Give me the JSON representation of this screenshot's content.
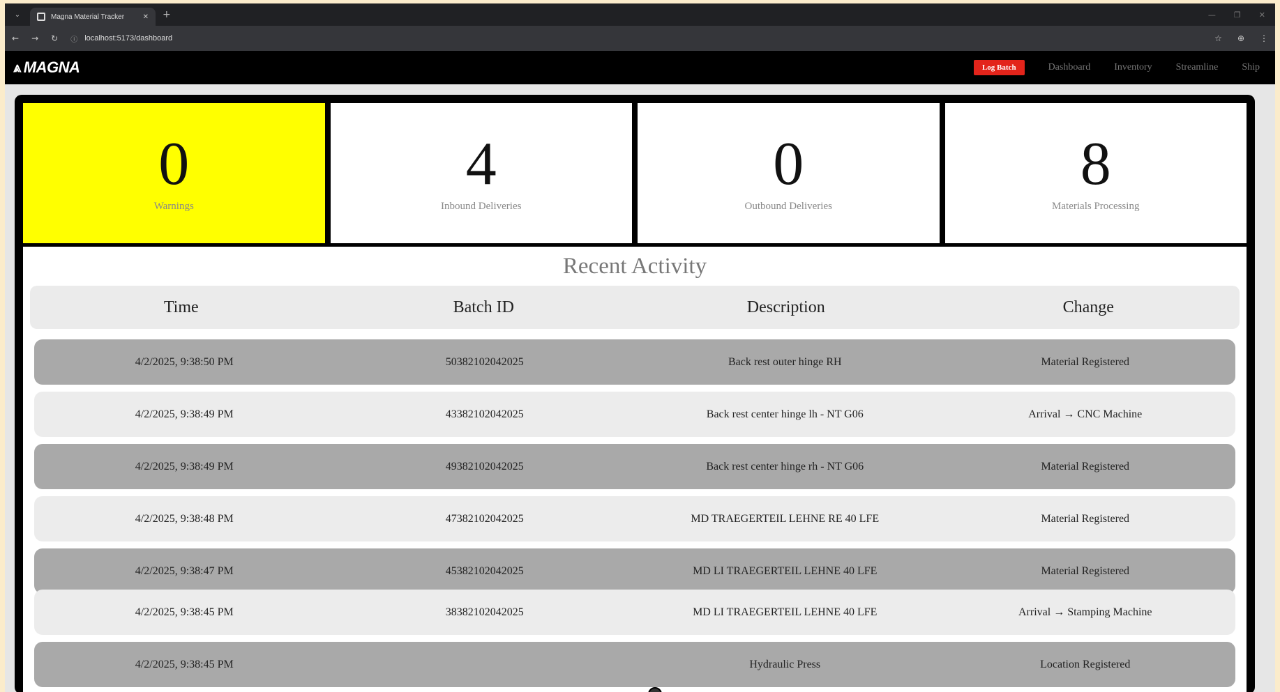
{
  "browser": {
    "tab_title": "Magna Material Tracker",
    "url": "localhost:5173/dashboard"
  },
  "navbar": {
    "logo_text": "MAGNA",
    "logo_icon": "magna-chevron-logo",
    "cta_label": "Log Batch",
    "links": [
      "Dashboard",
      "Inventory",
      "Streamline",
      "Ship"
    ],
    "accent_color": "#e3241b"
  },
  "stats": [
    {
      "value": "0",
      "label": "Warnings",
      "color": "#ffff00"
    },
    {
      "value": "4",
      "label": "Inbound Deliveries"
    },
    {
      "value": "0",
      "label": "Outbound Deliveries"
    },
    {
      "value": "8",
      "label": "Materials Processing"
    }
  ],
  "activity": {
    "title": "Recent Activity",
    "columns": [
      "Time",
      "Batch ID",
      "Description",
      "Change"
    ],
    "rows": [
      [
        "4/2/2025, 9:38:50 PM",
        "50382102042025",
        "Back rest outer hinge RH",
        "Material Registered"
      ],
      [
        "4/2/2025, 9:38:49 PM",
        "43382102042025",
        "Back rest center hinge lh - NT G06",
        "Arrival → CNC Machine"
      ],
      [
        "4/2/2025, 9:38:49 PM",
        "49382102042025",
        "Back rest center hinge rh - NT G06",
        "Material Registered"
      ],
      [
        "4/2/2025, 9:38:48 PM",
        "47382102042025",
        "MD TRAEGERTEIL LEHNE RE 40 LFE",
        "Material Registered"
      ],
      [
        "4/2/2025, 9:38:47 PM",
        "45382102042025",
        "MD LI TRAEGERTEIL LEHNE 40 LFE",
        "Material Registered"
      ],
      [
        "4/2/2025, 9:38:45 PM",
        "38382102042025",
        "MD LI TRAEGERTEIL LEHNE 40 LFE",
        "Arrival → Stamping Machine"
      ],
      [
        "4/2/2025, 9:38:45 PM",
        "",
        "Hydraulic Press",
        "Location Registered"
      ]
    ]
  }
}
